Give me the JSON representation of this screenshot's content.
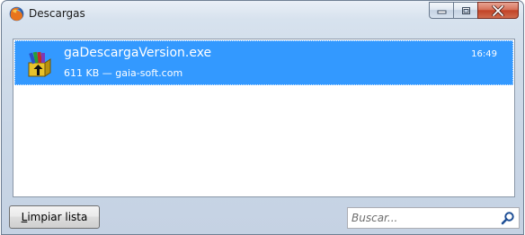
{
  "window": {
    "title": "Descargas",
    "app_icon": "firefox-icon",
    "caption_buttons": [
      "minimize-icon",
      "maximize-icon",
      "close-icon"
    ]
  },
  "downloads": [
    {
      "icon": "installer-package-icon",
      "name": "gaDescargaVersion.exe",
      "info": "611 KB — gaia-soft.com",
      "time": "16:49",
      "selected": true
    }
  ],
  "footer": {
    "clear_label_accel": "L",
    "clear_label_rest": "impiar lista",
    "search_placeholder": "Buscar...",
    "search_icon": "search-icon"
  },
  "colors": {
    "selection": "#3399ff",
    "selection_text": "#ffffff",
    "close_button": "#c24327"
  }
}
